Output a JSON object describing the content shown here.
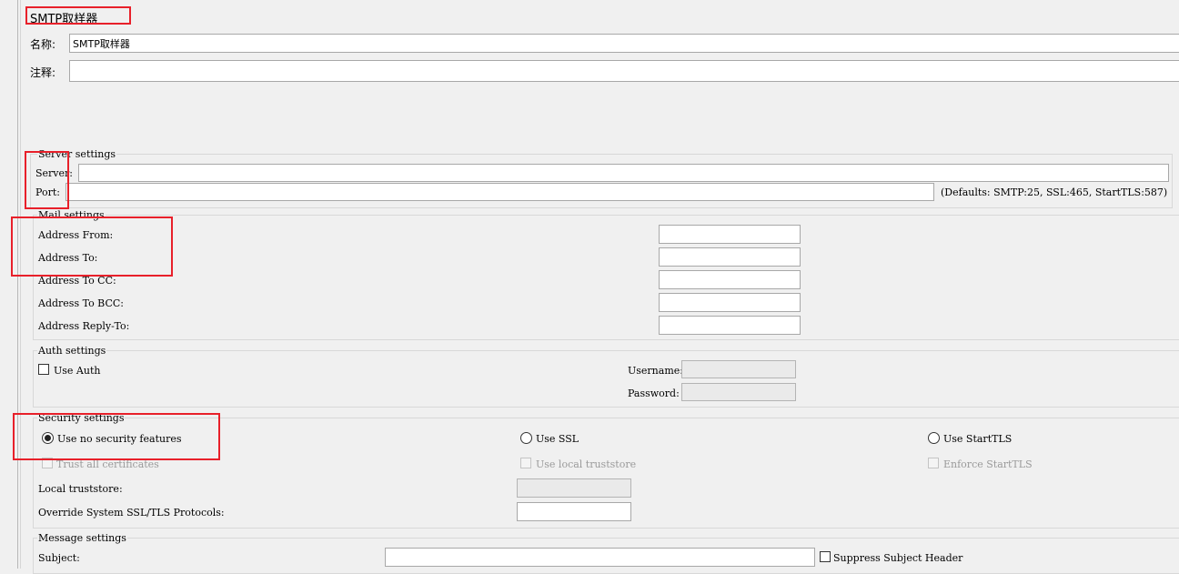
{
  "panel": {
    "title": "SMTP取样器",
    "name_label": "名称:",
    "name_value": "SMTP取样器",
    "comment_label": "注释:",
    "comment_value": ""
  },
  "server": {
    "legend": "Server settings",
    "server_label": "Server:",
    "port_label": "Port:",
    "defaults_text": "(Defaults: SMTP:25, SSL:465, StartTLS:587)"
  },
  "mail": {
    "legend": "Mail settings",
    "from_label": "Address From:",
    "to_label": "Address To:",
    "cc_label": "Address To CC:",
    "bcc_label": "Address To BCC:",
    "reply_label": "Address Reply-To:"
  },
  "auth": {
    "legend": "Auth settings",
    "use_auth_label": "Use Auth",
    "username_label": "Username:",
    "password_label": "Password:"
  },
  "security": {
    "legend": "Security settings",
    "no_security_label": "Use no security features",
    "ssl_label": "Use SSL",
    "starttls_label": "Use StartTLS",
    "trust_all_label": "Trust all certificates",
    "local_truststore_cb_label": "Use local truststore",
    "enforce_starttls_label": "Enforce StartTLS",
    "local_truststore_label": "Local truststore:",
    "override_protocols_label": "Override System SSL/TLS Protocols:"
  },
  "message": {
    "legend": "Message settings",
    "subject_label": "Subject:",
    "suppress_label": "Suppress Subject Header"
  },
  "colors": {
    "annotation": "#e8202a"
  }
}
